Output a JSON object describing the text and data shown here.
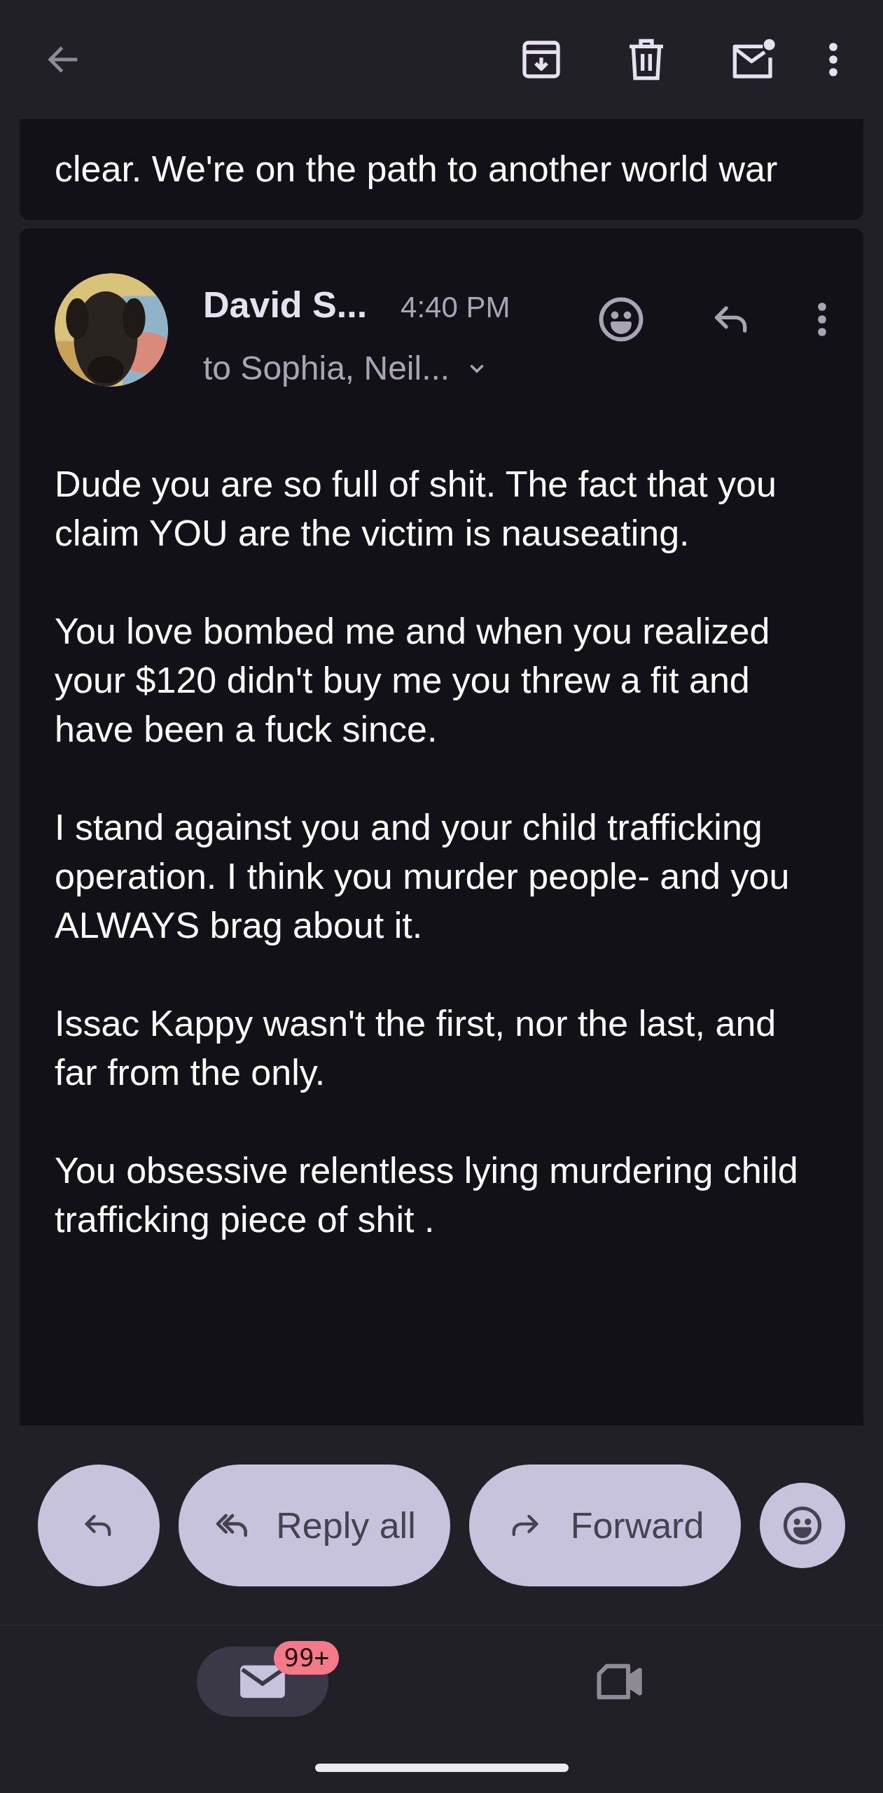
{
  "previous_message": {
    "paragraphs": [
      "clear. We're on the path to another world war"
    ]
  },
  "message": {
    "sender": "David S...",
    "time": "4:40 PM",
    "recipients": "to Sophia, Neil...",
    "paragraphs": [
      "Dude you are so full of shit. The fact that you claim YOU are the victim is nauseating.",
      "You love bombed me and when you realized your $120 didn't buy me you threw a fit and have been a fuck since.",
      "I stand against you and your child trafficking operation. I think you murder people- and you ALWAYS brag about it.",
      "Issac Kappy wasn't the first, nor the last, and far from the only.",
      "You obsessive relentless lying murdering child trafficking piece of shit ."
    ]
  },
  "actions": [
    {
      "kind": "reply"
    },
    {
      "kind": "reply_all",
      "label": "Reply all"
    },
    {
      "kind": "forward",
      "label": "Forward"
    },
    {
      "kind": "emoji"
    }
  ],
  "nav": [
    {
      "kind": "mail",
      "selected": true,
      "badge": "99+"
    },
    {
      "kind": "meet",
      "selected": false
    }
  ]
}
